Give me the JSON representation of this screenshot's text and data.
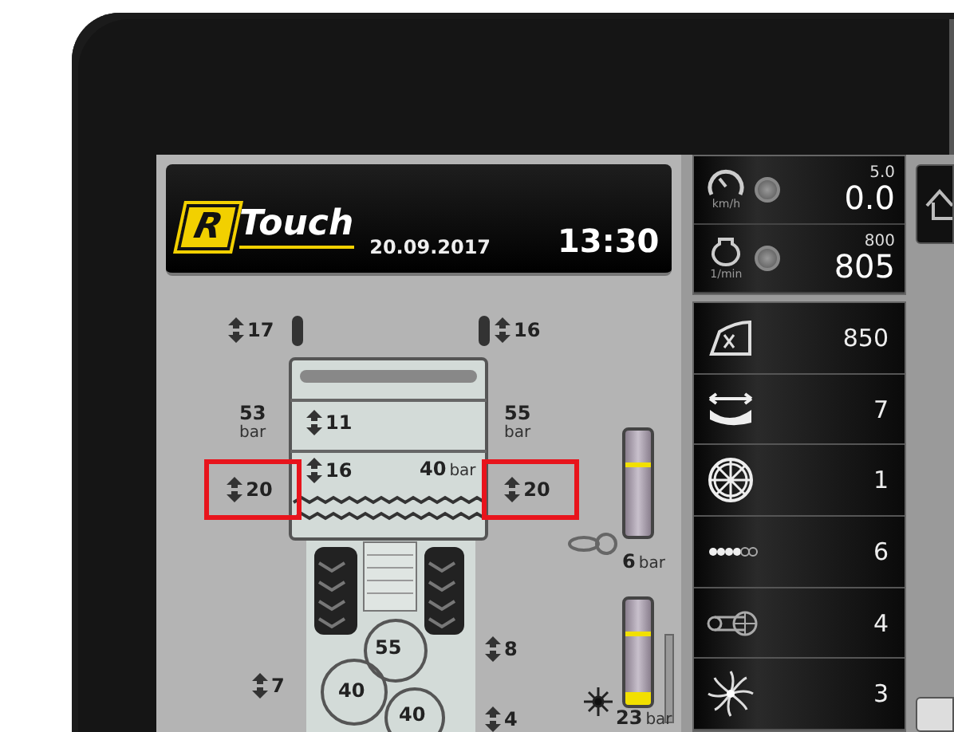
{
  "header": {
    "logo_letter": "R",
    "logo_word": "Touch",
    "date": "20.09.2017",
    "time": "13:30"
  },
  "diagram": {
    "labels": [
      {
        "kind": "lift",
        "value": "17",
        "highlighted": false
      },
      {
        "kind": "lift",
        "value": "16",
        "highlighted": false
      },
      {
        "kind": "pressure_stacked",
        "value": "53",
        "unit": "bar"
      },
      {
        "kind": "lift",
        "value": "11",
        "highlighted": false
      },
      {
        "kind": "pressure_stacked",
        "value": "55",
        "unit": "bar"
      },
      {
        "kind": "lift",
        "value": "16",
        "highlighted": false
      },
      {
        "kind": "pressure",
        "value": "40",
        "unit": "bar"
      },
      {
        "kind": "lift",
        "value": "20",
        "highlighted": true
      },
      {
        "kind": "lift",
        "value": "20",
        "highlighted": true
      },
      {
        "kind": "pressure",
        "value": "6",
        "unit": "bar"
      },
      {
        "kind": "rotor",
        "value": "55"
      },
      {
        "kind": "lift",
        "value": "8",
        "highlighted": false
      },
      {
        "kind": "lift",
        "value": "7",
        "highlighted": false
      },
      {
        "kind": "rotor",
        "value": "40"
      },
      {
        "kind": "rotor",
        "value": "40"
      },
      {
        "kind": "lift",
        "value": "4",
        "highlighted": false
      },
      {
        "kind": "pressure",
        "value": "23",
        "unit": "bar"
      }
    ],
    "fill_gauge": {
      "level": 0.12
    }
  },
  "drive": [
    {
      "kind": "speed",
      "setpoint": "5.0",
      "value": "0.0",
      "unit": "km/h"
    },
    {
      "kind": "rpm",
      "setpoint": "800",
      "value": "805",
      "unit": "1/min"
    }
  ],
  "counters": [
    {
      "kind": "area",
      "value": "850"
    },
    {
      "kind": "width",
      "value": "7"
    },
    {
      "kind": "wheel",
      "value": "1"
    },
    {
      "kind": "chain",
      "value": "6"
    },
    {
      "kind": "belt",
      "value": "4"
    },
    {
      "kind": "fan",
      "value": "3"
    }
  ]
}
